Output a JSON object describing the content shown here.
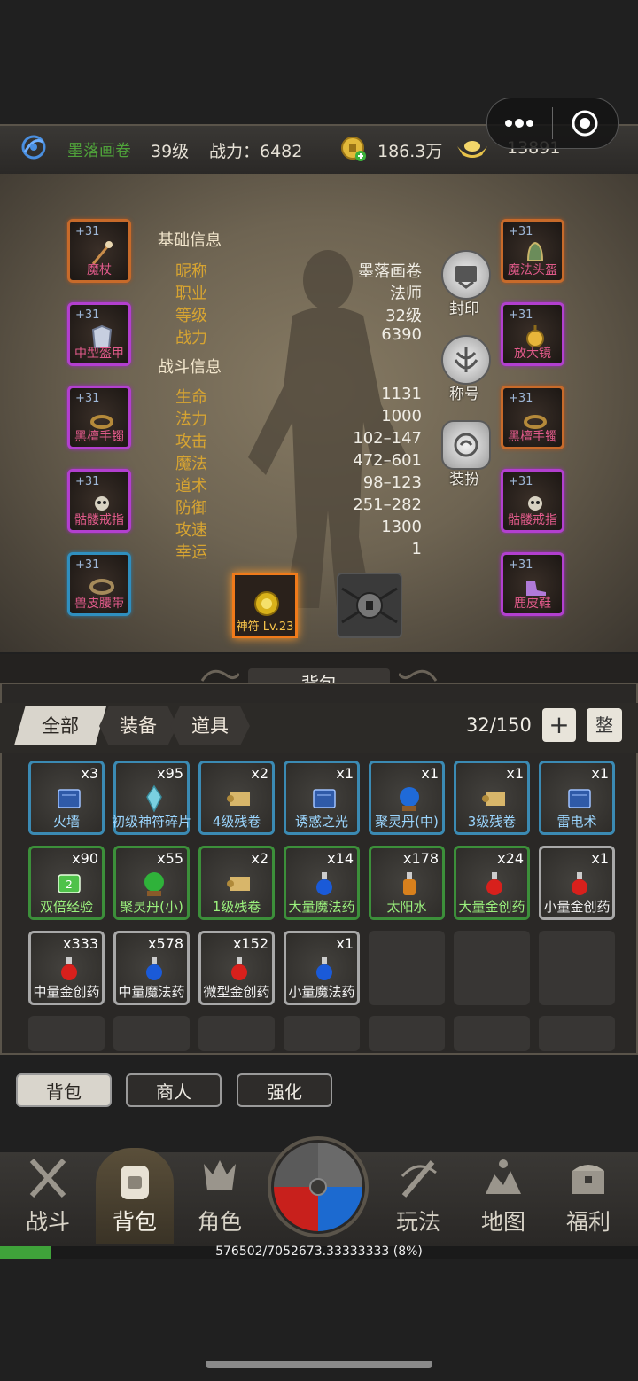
{
  "header": {
    "player_name": "墨落画卷",
    "level": "39级",
    "power_label": "战力：6482",
    "gold": "186.3万",
    "ingots": "13891"
  },
  "equip_left": [
    {
      "plus": "+31",
      "name": "魔杖",
      "rarity": "orange"
    },
    {
      "plus": "+31",
      "name": "中型盔甲",
      "rarity": "purple"
    },
    {
      "plus": "+31",
      "name": "黑檀手镯",
      "rarity": "purple"
    },
    {
      "plus": "+31",
      "name": "骷髅戒指",
      "rarity": "purple"
    },
    {
      "plus": "+31",
      "name": "兽皮腰带",
      "rarity": "blue"
    }
  ],
  "equip_right": [
    {
      "plus": "+31",
      "name": "魔法头盔",
      "rarity": "orange"
    },
    {
      "plus": "+31",
      "name": "放大镜",
      "rarity": "purple"
    },
    {
      "plus": "+31",
      "name": "黑檀手镯",
      "rarity": "orange"
    },
    {
      "plus": "+31",
      "name": "骷髅戒指",
      "rarity": "purple"
    },
    {
      "plus": "+31",
      "name": "鹿皮鞋",
      "rarity": "purple"
    }
  ],
  "basic_info": {
    "title": "基础信息",
    "rows": [
      {
        "label": "昵称",
        "value": "墨落画卷"
      },
      {
        "label": "职业",
        "value": "法师"
      },
      {
        "label": "等级",
        "value": "32级"
      },
      {
        "label": "战力",
        "value": "6390"
      }
    ]
  },
  "combat_info": {
    "title": "战斗信息",
    "rows": [
      {
        "label": "生命",
        "value": "1131"
      },
      {
        "label": "法力",
        "value": "1000"
      },
      {
        "label": "攻击",
        "value": "102–147"
      },
      {
        "label": "魔法",
        "value": "472–601"
      },
      {
        "label": "道术",
        "value": "98–123"
      },
      {
        "label": "防御",
        "value": "251–282"
      },
      {
        "label": "攻速",
        "value": "1300"
      },
      {
        "label": "幸运",
        "value": "1"
      }
    ]
  },
  "side_buttons": [
    "封印",
    "称号",
    "装扮"
  ],
  "talisman": "神符 Lv.23",
  "bag": {
    "title": "背包",
    "tabs": [
      "全部",
      "装备",
      "道具"
    ],
    "capacity": "32/150",
    "add_label": "+",
    "sort_label": "整",
    "items": [
      {
        "qty": "x3",
        "name": "火墙",
        "rarity": "blue",
        "icon": "book"
      },
      {
        "qty": "x95",
        "name": "初级神符碎片",
        "rarity": "blue",
        "icon": "crystal"
      },
      {
        "qty": "x2",
        "name": "4级残卷",
        "rarity": "blue",
        "icon": "scroll"
      },
      {
        "qty": "x1",
        "name": "诱惑之光",
        "rarity": "blue",
        "icon": "book"
      },
      {
        "qty": "x1",
        "name": "聚灵丹(中)",
        "rarity": "blue",
        "icon": "orb-blue"
      },
      {
        "qty": "x1",
        "name": "3级残卷",
        "rarity": "blue",
        "icon": "scroll"
      },
      {
        "qty": "x1",
        "name": "雷电术",
        "rarity": "blue",
        "icon": "book"
      },
      {
        "qty": "x90",
        "name": "双倍经验",
        "rarity": "green",
        "icon": "ticket"
      },
      {
        "qty": "x55",
        "name": "聚灵丹(小)",
        "rarity": "green",
        "icon": "orb-green"
      },
      {
        "qty": "x2",
        "name": "1级残卷",
        "rarity": "green",
        "icon": "scroll"
      },
      {
        "qty": "x14",
        "name": "大量魔法药",
        "rarity": "green",
        "icon": "potion-blue"
      },
      {
        "qty": "x178",
        "name": "太阳水",
        "rarity": "green",
        "icon": "potion-orange"
      },
      {
        "qty": "x24",
        "name": "大量金创药",
        "rarity": "green",
        "icon": "potion-red"
      },
      {
        "qty": "x1",
        "name": "小量金创药",
        "rarity": "white",
        "icon": "potion-red"
      },
      {
        "qty": "x333",
        "name": "中量金创药",
        "rarity": "white",
        "icon": "potion-red"
      },
      {
        "qty": "x578",
        "name": "中量魔法药",
        "rarity": "white",
        "icon": "potion-blue"
      },
      {
        "qty": "x152",
        "name": "微型金创药",
        "rarity": "white",
        "icon": "potion-red"
      },
      {
        "qty": "x1",
        "name": "小量魔法药",
        "rarity": "white",
        "icon": "potion-blue"
      }
    ]
  },
  "sub_tabs": [
    "背包",
    "商人",
    "强化"
  ],
  "nav": [
    "战斗",
    "背包",
    "角色",
    "玩法",
    "地图",
    "福利"
  ],
  "exp": {
    "text": "576502/7052673.33333333 (8%)",
    "fraction": 0.08
  },
  "colors": {
    "gold_label": "#d7a431",
    "name_green": "#4fa23a",
    "exp_bar": "#3fa33a"
  }
}
